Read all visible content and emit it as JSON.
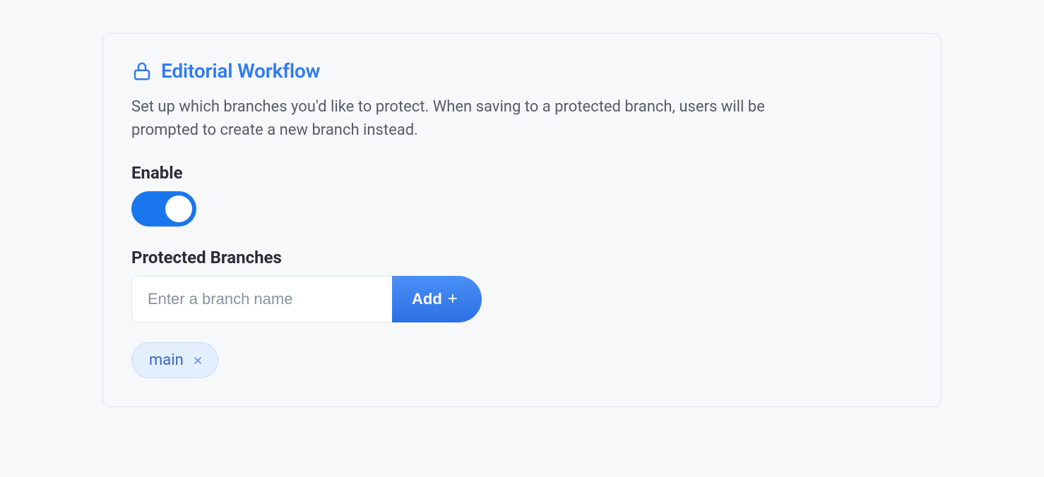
{
  "card": {
    "title": "Editorial Workflow",
    "description": "Set up which branches you'd like to protect. When saving to a protected branch, users will be prompted to create a new branch instead."
  },
  "enable": {
    "label": "Enable",
    "value": true
  },
  "protectedBranches": {
    "label": "Protected Branches",
    "inputPlaceholder": "Enter a branch name",
    "addButtonLabel": "Add",
    "items": [
      {
        "name": "main"
      }
    ]
  }
}
